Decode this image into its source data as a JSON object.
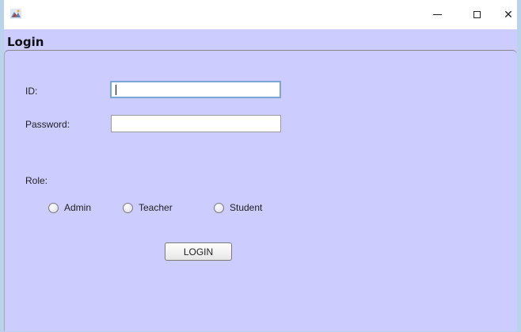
{
  "window": {
    "icon": "java-app-icon",
    "controls": {
      "minimize_icon": "minimize-icon",
      "maximize_icon": "maximize-icon",
      "close_icon": "close-icon",
      "close_glyph": "✕"
    }
  },
  "frame": {
    "title": "Login"
  },
  "form": {
    "id_label": "ID:",
    "id_value": "",
    "password_label": "Password:",
    "password_value": "",
    "role_label": "Role:",
    "roles": [
      {
        "label": "Admin",
        "selected": false
      },
      {
        "label": "Teacher",
        "selected": false
      },
      {
        "label": "Student",
        "selected": false
      }
    ],
    "login_button": "LOGIN"
  },
  "colors": {
    "panel_background": "#ccccff",
    "titlebar_background": "#ffffff",
    "window_border": "#b9d3ed",
    "focus_border": "#7ba7d6"
  }
}
